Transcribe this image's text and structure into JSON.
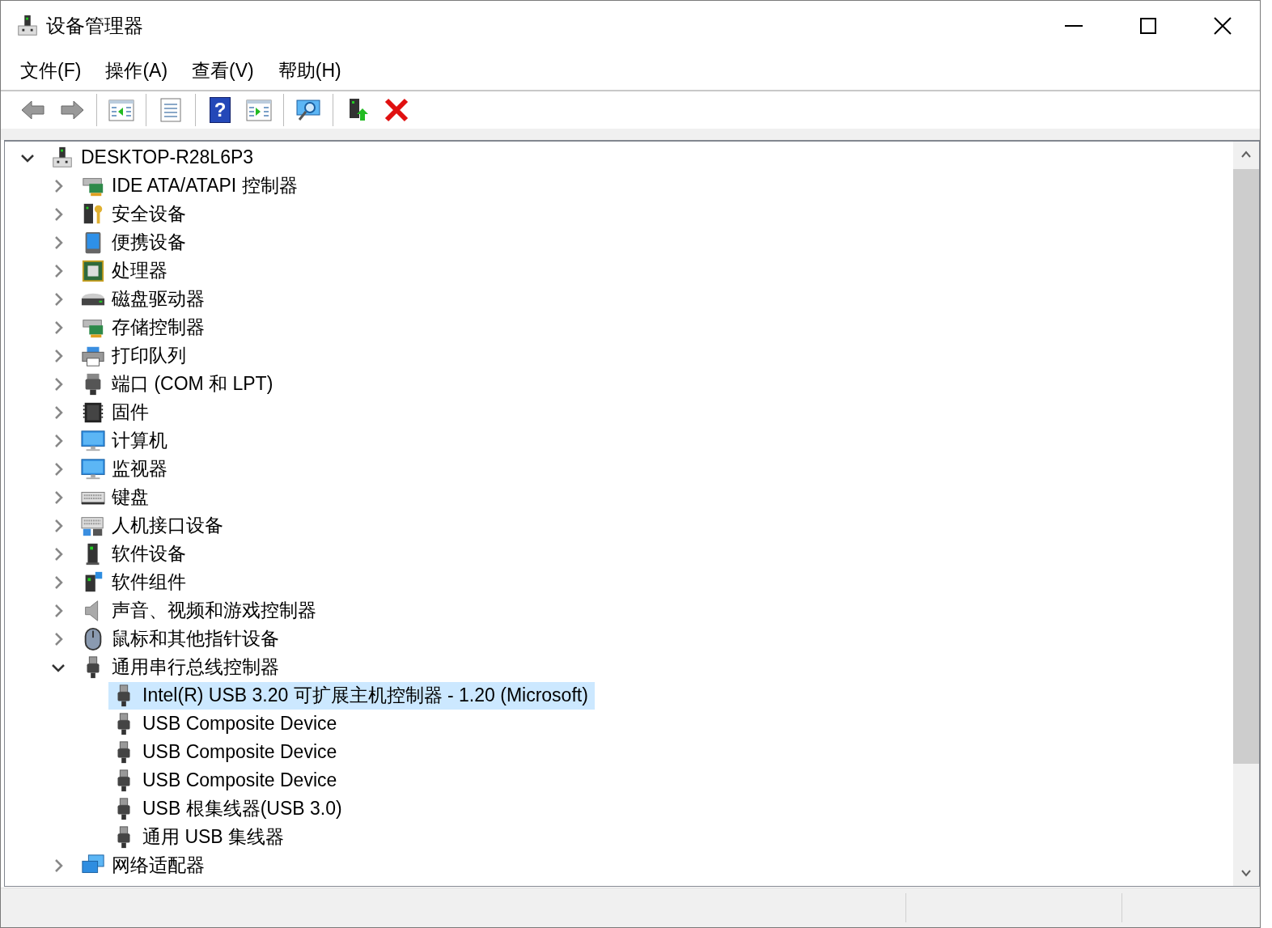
{
  "window": {
    "title": "设备管理器"
  },
  "menu": [
    "文件(F)",
    "操作(A)",
    "查看(V)",
    "帮助(H)"
  ],
  "toolbar": [
    [
      {
        "kind": "back"
      },
      {
        "kind": "forward"
      }
    ],
    [
      {
        "kind": "tree-pane"
      }
    ],
    [
      {
        "kind": "properties"
      }
    ],
    [
      {
        "kind": "help",
        "glyph": "?"
      },
      {
        "kind": "action-pane"
      }
    ],
    [
      {
        "kind": "scan"
      }
    ],
    [
      {
        "kind": "update"
      },
      {
        "kind": "uninstall"
      }
    ]
  ],
  "tree": [
    {
      "label": "DESKTOP-R28L6P3",
      "expanded": true,
      "selected": false,
      "children": [
        {
          "label": "IDE ATA/ATAPI 控制器",
          "expanded": false,
          "selected": false
        },
        {
          "label": "安全设备",
          "expanded": false,
          "selected": false
        },
        {
          "label": "便携设备",
          "expanded": false,
          "selected": false
        },
        {
          "label": "处理器",
          "expanded": false,
          "selected": false
        },
        {
          "label": "磁盘驱动器",
          "expanded": false,
          "selected": false
        },
        {
          "label": "存储控制器",
          "expanded": false,
          "selected": false
        },
        {
          "label": "打印队列",
          "expanded": false,
          "selected": false
        },
        {
          "label": "端口 (COM 和 LPT)",
          "expanded": false,
          "selected": false
        },
        {
          "label": "固件",
          "expanded": false,
          "selected": false
        },
        {
          "label": "计算机",
          "expanded": false,
          "selected": false
        },
        {
          "label": "监视器",
          "expanded": false,
          "selected": false
        },
        {
          "label": "键盘",
          "expanded": false,
          "selected": false
        },
        {
          "label": "人机接口设备",
          "expanded": false,
          "selected": false
        },
        {
          "label": "软件设备",
          "expanded": false,
          "selected": false
        },
        {
          "label": "软件组件",
          "expanded": false,
          "selected": false
        },
        {
          "label": "声音、视频和游戏控制器",
          "expanded": false,
          "selected": false
        },
        {
          "label": "鼠标和其他指针设备",
          "expanded": false,
          "selected": false
        },
        {
          "label": "通用串行总线控制器",
          "expanded": true,
          "selected": false,
          "children": [
            {
              "label": "Intel(R) USB 3.20 可扩展主机控制器 - 1.20 (Microsoft)",
              "selected": true
            },
            {
              "label": "USB Composite Device",
              "selected": false
            },
            {
              "label": "USB Composite Device",
              "selected": false
            },
            {
              "label": "USB Composite Device",
              "selected": false
            },
            {
              "label": "USB 根集线器(USB 3.0)",
              "selected": false
            },
            {
              "label": "通用 USB 集线器",
              "selected": false
            }
          ]
        },
        {
          "label": "网络适配器",
          "expanded": false,
          "selected": false
        }
      ]
    }
  ]
}
